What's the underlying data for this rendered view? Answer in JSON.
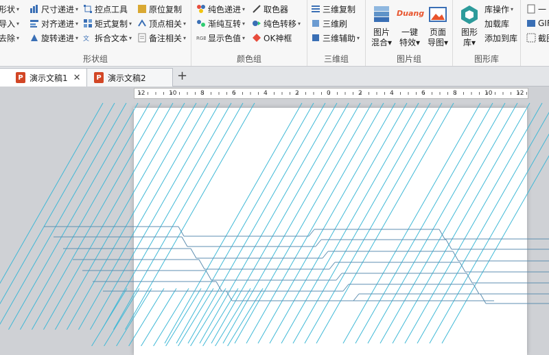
{
  "ribbon": {
    "group1": {
      "label": "形状组",
      "col_a": [
        "形状",
        "导入",
        "去除"
      ],
      "col_b": [
        "尺寸递进",
        "对齐递进",
        "旋转递进"
      ],
      "col_c": [
        "控点工具",
        "矩式复制",
        "拆合文本"
      ],
      "col_d": [
        "原位复制",
        "顶点相关",
        "备注相关"
      ]
    },
    "group2": {
      "label": "颜色组",
      "col_a": [
        "纯色递进",
        "渐纯互转",
        "显示色值"
      ],
      "col_b": [
        "取色器",
        "纯色转移",
        "OK神框"
      ]
    },
    "group3": {
      "label": "三维组",
      "items": [
        "三维复制",
        "三维刷",
        "三维辅助"
      ]
    },
    "group4": {
      "label": "图片组",
      "duang_text": "Duang",
      "buttons": [
        {
          "l1": "图片",
          "l2": "混合"
        },
        {
          "l1": "一键",
          "l2": "特效"
        },
        {
          "l1": "页面",
          "l2": "导图"
        }
      ]
    },
    "group5": {
      "label": "图形库",
      "big": {
        "l1": "图形",
        "l2": "库"
      },
      "items": [
        "库操作",
        "加载库",
        "添加到库"
      ]
    },
    "group6": {
      "items": [
        "一",
        "GIF",
        "截图"
      ]
    }
  },
  "tabs": {
    "doc1": "演示文稿1",
    "doc2": "演示文稿2",
    "add": "+",
    "close": "✕",
    "ppt_letter": "P"
  },
  "ruler": {
    "labels": [
      "12",
      "10",
      "8",
      "6",
      "4",
      "2",
      "0",
      "2",
      "4",
      "6",
      "8",
      "10",
      "12"
    ]
  },
  "colors": {
    "line_cyan": "#3fb8d6",
    "line_slate": "#5c8eb0",
    "ribbon_bg": "#f7f7f7",
    "workspace": "#cfd1d5"
  }
}
